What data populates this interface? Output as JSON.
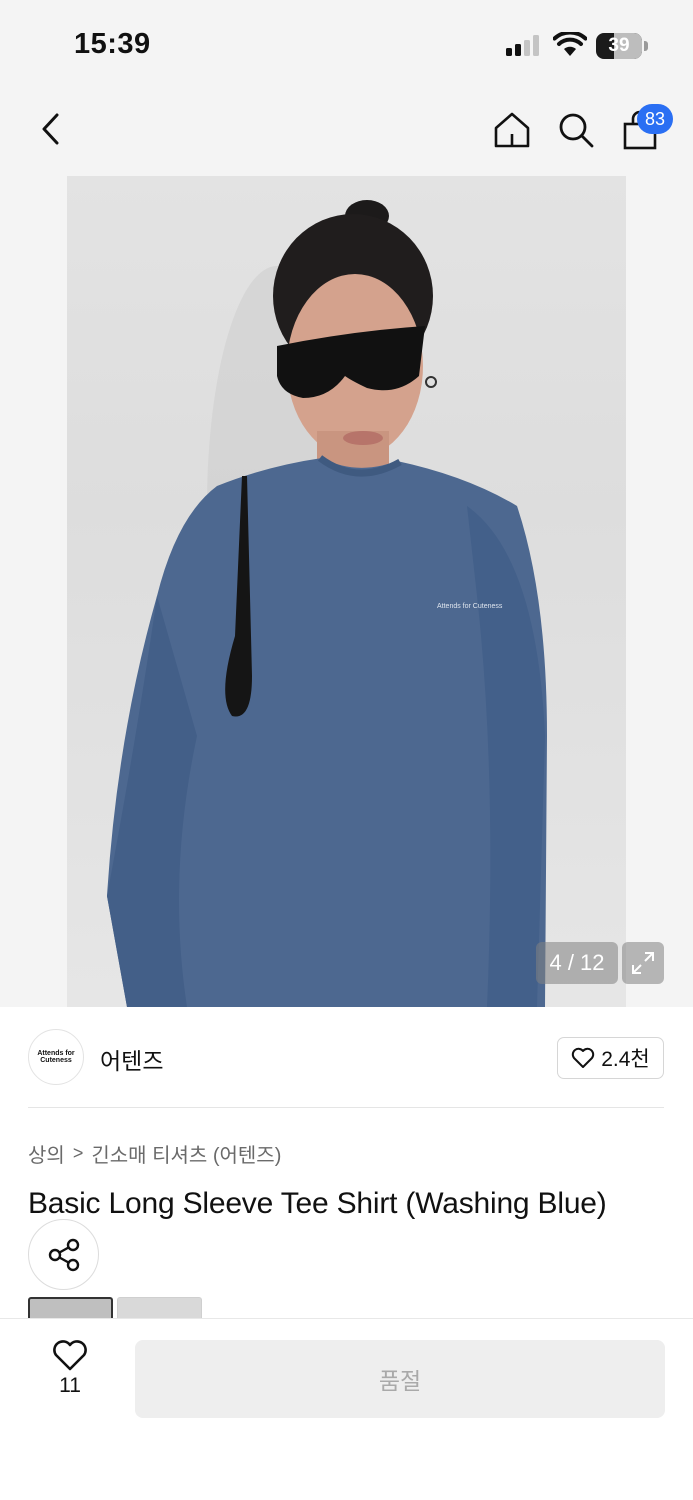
{
  "status_bar": {
    "time": "15:39",
    "battery_percent": "39",
    "battery_level": 0.39
  },
  "nav": {
    "back_icon": "chevron-left-icon",
    "home_icon": "home-icon",
    "search_icon": "search-icon",
    "cart_icon": "shopping-bag-icon",
    "cart_count": "83",
    "badge_color": "#2a6ff3"
  },
  "gallery": {
    "counter": "4 / 12",
    "expand_icon": "expand-icon",
    "shirt_print": "Attends for Cuteness"
  },
  "brand": {
    "logo_line1": "Attends for",
    "logo_line2": "Cuteness",
    "name": "어텐즈",
    "likes": "2.4천"
  },
  "breadcrumb": {
    "category": "상의",
    "separator": ">",
    "subcategory": "긴소매 티셔츠 (어텐즈)"
  },
  "product": {
    "title": "Basic Long Sleeve Tee Shirt (Washing Blue)"
  },
  "share": {
    "icon": "share-icon"
  },
  "bottom_bar": {
    "wish_count": "11",
    "soldout_label": "품절"
  }
}
